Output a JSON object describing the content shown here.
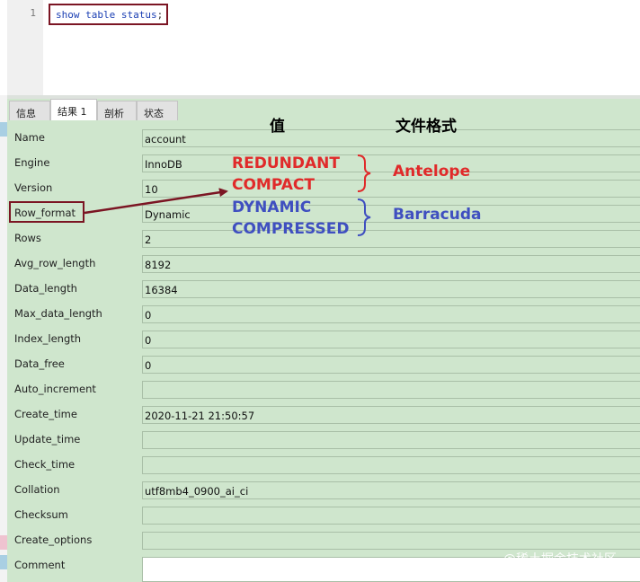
{
  "editor": {
    "line_number": "1",
    "sql": "show table status",
    "sql_terminator": ";"
  },
  "tabs": [
    {
      "label": "信息",
      "active": false
    },
    {
      "label": "结果 1",
      "active": true
    },
    {
      "label": "剖析",
      "active": false
    },
    {
      "label": "状态",
      "active": false
    }
  ],
  "fields": [
    {
      "name": "Name",
      "value": "account"
    },
    {
      "name": "Engine",
      "value": "InnoDB"
    },
    {
      "name": "Version",
      "value": "10"
    },
    {
      "name": "Row_format",
      "value": "Dynamic"
    },
    {
      "name": "Rows",
      "value": "2"
    },
    {
      "name": "Avg_row_length",
      "value": "8192"
    },
    {
      "name": "Data_length",
      "value": "16384"
    },
    {
      "name": "Max_data_length",
      "value": "0"
    },
    {
      "name": "Index_length",
      "value": "0"
    },
    {
      "name": "Data_free",
      "value": "0"
    },
    {
      "name": "Auto_increment",
      "value": ""
    },
    {
      "name": "Create_time",
      "value": "2020-11-21 21:50:57"
    },
    {
      "name": "Update_time",
      "value": ""
    },
    {
      "name": "Check_time",
      "value": ""
    },
    {
      "name": "Collation",
      "value": "utf8mb4_0900_ai_ci"
    },
    {
      "name": "Checksum",
      "value": ""
    },
    {
      "name": "Create_options",
      "value": ""
    },
    {
      "name": "Comment",
      "value": ""
    }
  ],
  "annotation": {
    "value_header": "值",
    "format_header": "文件格式",
    "antelope_values": [
      "REDUNDANT",
      "COMPACT"
    ],
    "antelope_label": "Antelope",
    "barracuda_values": [
      "DYNAMIC",
      "COMPRESSED"
    ],
    "barracuda_label": "Barracuda",
    "red_color": "#e02a2a",
    "blue_color": "#3f4fc0",
    "highlight_color": "#7b1523"
  },
  "watermark": "@稀土掘金技术社区"
}
